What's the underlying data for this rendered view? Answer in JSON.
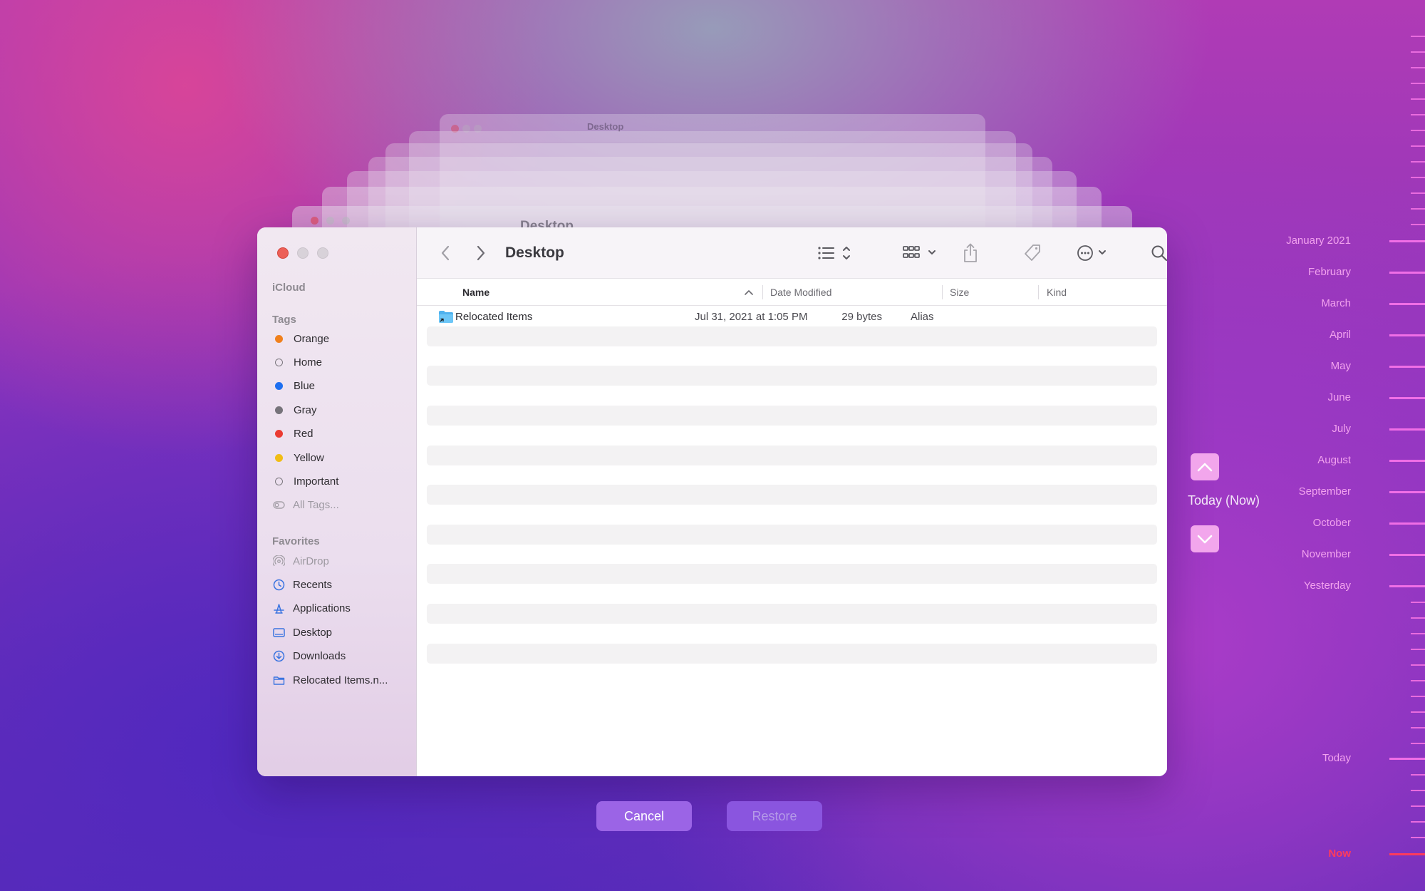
{
  "window": {
    "title": "Desktop"
  },
  "sidebar": {
    "icloud_label": "iCloud",
    "tags_label": "Tags",
    "tags": [
      {
        "label": "Orange",
        "color": "#f0801c",
        "hollow": false
      },
      {
        "label": "Home",
        "color": "",
        "hollow": true
      },
      {
        "label": "Blue",
        "color": "#1e6ff0",
        "hollow": false
      },
      {
        "label": "Gray",
        "color": "#76737a",
        "hollow": false
      },
      {
        "label": "Red",
        "color": "#eb3b32",
        "hollow": false
      },
      {
        "label": "Yellow",
        "color": "#f1bd14",
        "hollow": false
      },
      {
        "label": "Important",
        "color": "",
        "hollow": true
      },
      {
        "label": "All Tags...",
        "color": "",
        "muted": true
      }
    ],
    "favorites_label": "Favorites",
    "favorites": [
      {
        "label": "AirDrop",
        "icon": "airdrop-icon",
        "muted": true
      },
      {
        "label": "Recents",
        "icon": "clock-icon"
      },
      {
        "label": "Applications",
        "icon": "applications-icon"
      },
      {
        "label": "Desktop",
        "icon": "desktop-icon"
      },
      {
        "label": "Downloads",
        "icon": "download-icon"
      },
      {
        "label": "Relocated Items.n...",
        "icon": "folder-icon"
      }
    ]
  },
  "columns": {
    "name": "Name",
    "date_modified": "Date Modified",
    "size": "Size",
    "kind": "Kind"
  },
  "files": [
    {
      "name": "Relocated Items",
      "date_modified": "Jul 31, 2021 at 1:05 PM",
      "size": "29 bytes",
      "kind": "Alias",
      "icon": "alias-folder-icon"
    }
  ],
  "buttons": {
    "cancel": "Cancel",
    "restore": "Restore"
  },
  "navigator": {
    "current": "Today (Now)"
  },
  "timeline": {
    "labels": [
      "January 2021",
      "February",
      "March",
      "April",
      "May",
      "June",
      "July",
      "August",
      "September",
      "October",
      "November",
      "Yesterday",
      "Today",
      "Now"
    ]
  },
  "colors": {
    "accent": "#9b64e6",
    "timeline": "#f06ee6",
    "now": "#ff3b5c"
  }
}
